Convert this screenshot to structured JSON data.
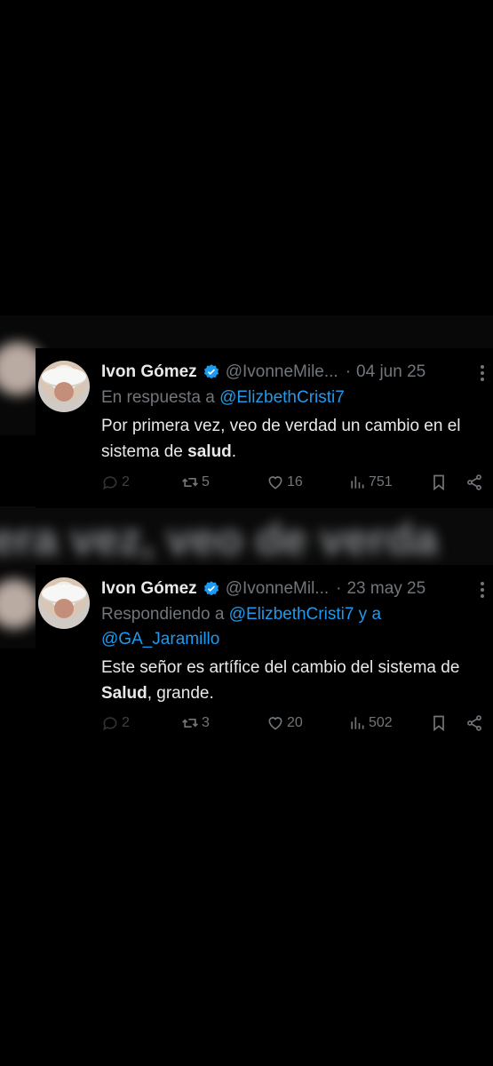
{
  "colors": {
    "background": "#000000",
    "accent": "#1d9bf0",
    "muted": "#71767b",
    "text": "#e7e9ea"
  },
  "blurred_text": "era vez, veo de verda",
  "tweets": [
    {
      "name": "Ivon Gómez",
      "handle": "@IvonneMile...",
      "dot": "·",
      "date": "04 jun 25",
      "reply_prefix": "En respuesta a",
      "reply_mentions": "@ElizbethCristi7",
      "reply_mentions_2": "",
      "text_before": "Por primera vez, veo de verdad un cambio en el sistema de ",
      "text_bold": "salud",
      "text_after": ".",
      "replies": "2",
      "retweets": "5",
      "likes": "16",
      "views": "751"
    },
    {
      "name": "Ivon Gómez",
      "handle": "@IvonneMil...",
      "dot": "·",
      "date": "23 may 25",
      "reply_prefix": "Respondiendo a",
      "reply_mentions": "@ElizbethCristi7 y a",
      "reply_mentions_2": "@GA_Jaramillo",
      "text_before": "Este señor es artífice del cambio del sistema de ",
      "text_bold": "Salud",
      "text_after": ", grande.",
      "replies": "2",
      "retweets": "3",
      "likes": "20",
      "views": "502"
    }
  ]
}
